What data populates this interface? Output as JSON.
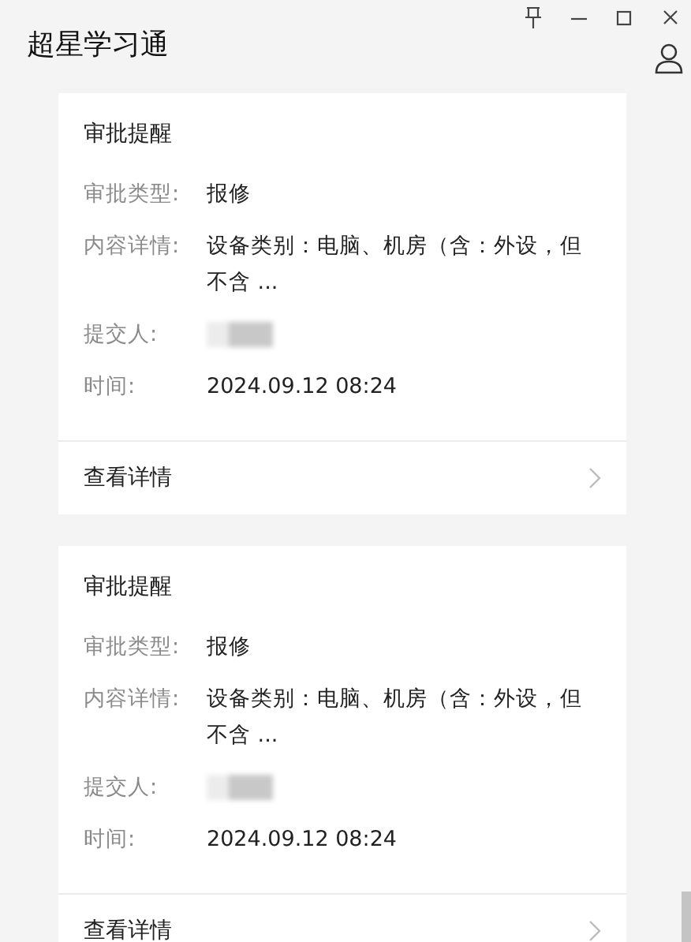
{
  "window": {
    "title": "超星学习通"
  },
  "cards": [
    {
      "title": "审批提醒",
      "fields": [
        {
          "kind": "text",
          "label": "审批类型:",
          "value": "报修"
        },
        {
          "kind": "text",
          "label": "内容详情:",
          "value": "设备类别：电脑、机房（含：外设，但不含 ..."
        },
        {
          "kind": "redacted",
          "label": "提交人:"
        },
        {
          "kind": "text",
          "label": "时间:",
          "value": "2024.09.12 08:24"
        }
      ],
      "link": "查看详情"
    },
    {
      "title": "审批提醒",
      "fields": [
        {
          "kind": "text",
          "label": "审批类型:",
          "value": "报修"
        },
        {
          "kind": "text",
          "label": "内容详情:",
          "value": "设备类别：电脑、机房（含：外设，但不含 ..."
        },
        {
          "kind": "redacted",
          "label": "提交人:"
        },
        {
          "kind": "text",
          "label": "时间:",
          "value": "2024.09.12 08:24"
        }
      ],
      "link": "查看详情"
    }
  ]
}
